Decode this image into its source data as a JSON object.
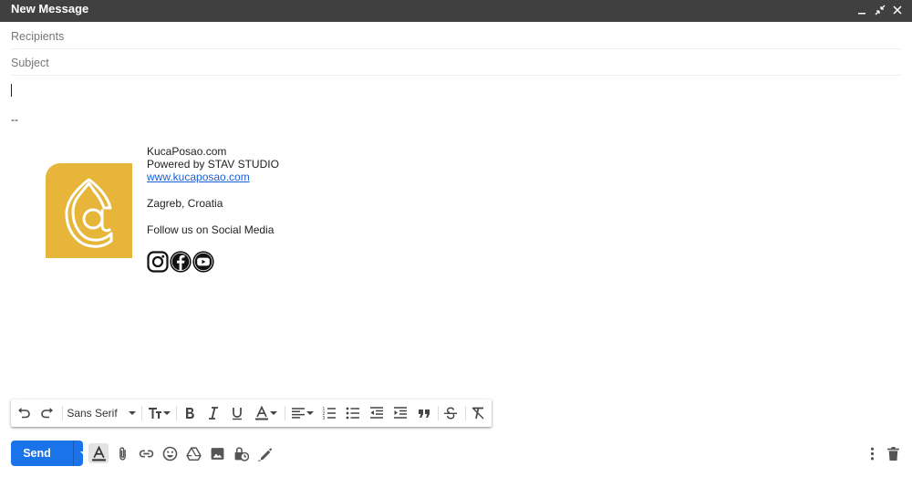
{
  "window": {
    "title": "New Message"
  },
  "fields": {
    "recipients_placeholder": "Recipients",
    "subject_placeholder": "Subject"
  },
  "body": {
    "separator": "--",
    "signature": {
      "company": "KucaPosao.com",
      "powered_by": "Powered by STAV STUDIO",
      "website": "www.kucaposao.com",
      "location": "Zagreb, Croatia",
      "follow": "Follow us on Social Media",
      "social_icons": [
        "instagram-icon",
        "facebook-icon",
        "youtube-icon"
      ]
    }
  },
  "formatting_toolbar": {
    "font": "Sans Serif",
    "icons": [
      "undo-icon",
      "redo-icon",
      "font-size-icon",
      "bold-icon",
      "italic-icon",
      "underline-icon",
      "text-color-icon",
      "align-icon",
      "numbered-list-icon",
      "bulleted-list-icon",
      "indent-less-icon",
      "indent-more-icon",
      "quote-icon",
      "strikethrough-icon",
      "remove-formatting-icon"
    ]
  },
  "bottom_toolbar": {
    "send_label": "Send",
    "icons": [
      "formatting-options-icon",
      "attach-icon",
      "link-icon",
      "emoji-icon",
      "drive-icon",
      "photo-icon",
      "confidential-mode-icon",
      "signature-icon",
      "more-options-icon",
      "delete-icon"
    ]
  },
  "colors": {
    "titlebar": "#404040",
    "send_button": "#1a73e8",
    "logo_background": "#e8b53b",
    "link": "#1a5fd6"
  }
}
